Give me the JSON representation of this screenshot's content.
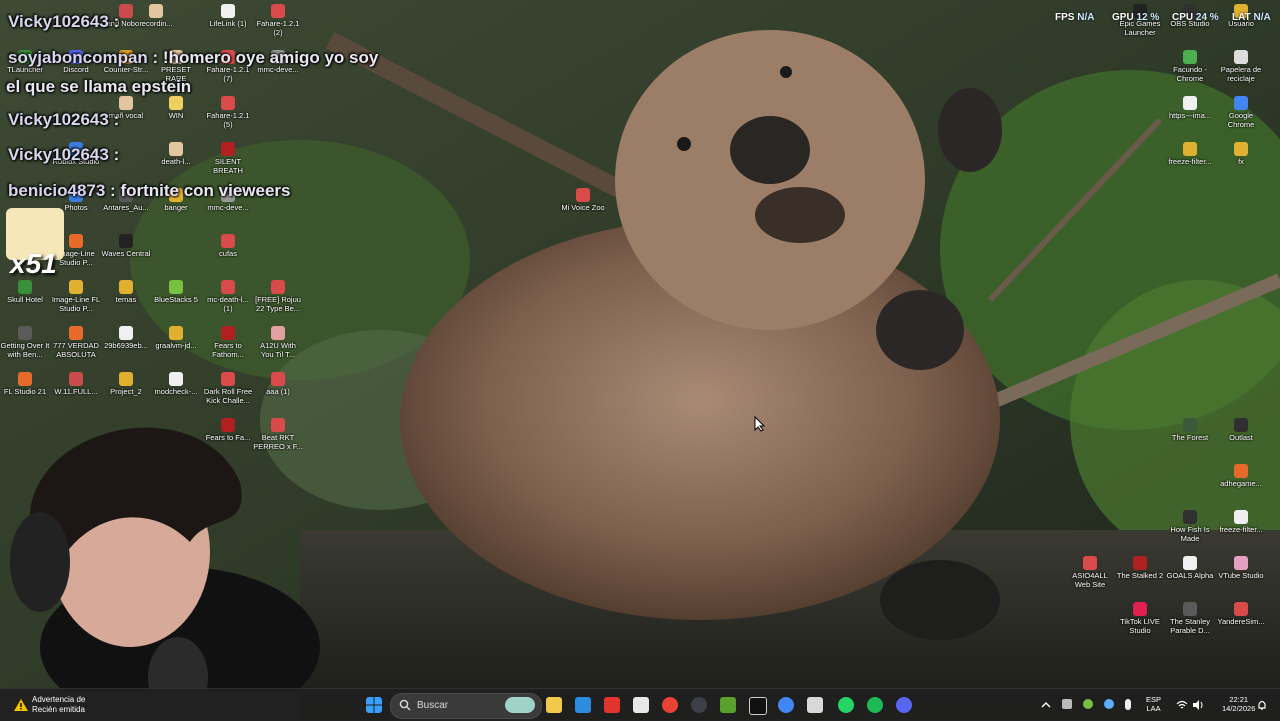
{
  "overlay": {
    "chat": [
      {
        "user": "Vicky102643",
        "sep": " :",
        "text": ""
      },
      {
        "user": "soyjaboncompan",
        "sep": " :",
        "text": " !homero oye amigo yo soy"
      },
      {
        "user": "",
        "sep": "",
        "text": "el que se llama epstein"
      },
      {
        "user": "Vicky102643",
        "sep": " :",
        "text": ""
      },
      {
        "user": "Vicky102643",
        "sep": " :",
        "text": ""
      },
      {
        "user": "benicio4873",
        "sep": " :",
        "text": " fortnite con vieweers"
      }
    ],
    "combo": "x51",
    "hud": {
      "fps_label": "FPS",
      "fps_value": "N/A",
      "gpu_label": "GPU",
      "gpu_value": "12 %",
      "cpu_label": "CPU",
      "cpu_value": "24 %",
      "lat_label": "LAT",
      "lat_value": "N/A"
    }
  },
  "desktop": {
    "icons": [
      {
        "label": "and Nobo...",
        "color": "#c94b4b"
      },
      {
        "label": "recordin...",
        "color": "#e3c6a0"
      },
      {
        "label": "LifeLink (1)",
        "color": "#f0f0f0"
      },
      {
        "label": "Fahare-1.2.1 (2)",
        "color": "#d94a4a"
      },
      {
        "label": "TLauncher",
        "color": "#3a8f3a"
      },
      {
        "label": "Discord",
        "color": "#5865f2"
      },
      {
        "label": "Counter-Str...",
        "color": "#e0a030"
      },
      {
        "label": "PRESET RARE",
        "color": "#e3c6a0"
      },
      {
        "label": "Fahare-1.2.1 (7)",
        "color": "#d94a4a"
      },
      {
        "label": "mmc-deve...",
        "color": "#999999"
      },
      {
        "label": "mañ vocal",
        "color": "#e3c6a0"
      },
      {
        "label": "WIN",
        "color": "#f0d060"
      },
      {
        "label": "Fahare-1.2.1 (5)",
        "color": "#d94a4a"
      },
      {
        "label": "Roblox Studio",
        "color": "#3b7de0"
      },
      {
        "label": "death-l...",
        "color": "#e3c6a0"
      },
      {
        "label": "SILENT BREATH",
        "color": "#b02020"
      },
      {
        "label": "Photos",
        "color": "#3b7de0"
      },
      {
        "label": "Antares_Au...",
        "color": "#5a5a5a"
      },
      {
        "label": "banger",
        "color": "#e0b030"
      },
      {
        "label": "mmc-deve...",
        "color": "#999999"
      },
      {
        "label": "Image-Line Studio P...",
        "color": "#e86a2a"
      },
      {
        "label": "Waves Central",
        "color": "#222222"
      },
      {
        "label": "cufas",
        "color": "#d94a4a"
      },
      {
        "label": "Skull Hotel",
        "color": "#3a8f3a"
      },
      {
        "label": "Image-Line FL Studio P...",
        "color": "#e0b030"
      },
      {
        "label": "temas",
        "color": "#e0b030"
      },
      {
        "label": "BlueStacks 5",
        "color": "#7ac043"
      },
      {
        "label": "mc-death-l... (1)",
        "color": "#d94a4a"
      },
      {
        "label": "[FREE] Rojuu 22 Type Be...",
        "color": "#d94a4a"
      },
      {
        "label": "Getting Over It with Ben...",
        "color": "#5a5a5a"
      },
      {
        "label": "777 VERDAD ABSOLUTA",
        "color": "#e86a2a"
      },
      {
        "label": "29b6939eb...",
        "color": "#f0f0f0"
      },
      {
        "label": "graalvm-jd...",
        "color": "#e0b030"
      },
      {
        "label": "Fears to Fathom...",
        "color": "#b02020"
      },
      {
        "label": "A12U With You Til T...",
        "color": "#e3a0a0"
      },
      {
        "label": "FL Studio 21",
        "color": "#e86a2a"
      },
      {
        "label": "W.11.FULL...",
        "color": "#c94b4b"
      },
      {
        "label": "Project_2",
        "color": "#e0b030"
      },
      {
        "label": "modcheck-...",
        "color": "#f0f0f0"
      },
      {
        "label": "Dark Roll Free Kick Challe...",
        "color": "#d94a4a"
      },
      {
        "label": "aaa (1)",
        "color": "#d94a4a"
      },
      {
        "label": "Fears to Fa...",
        "color": "#b02020"
      },
      {
        "label": "Beat RKT PERREO x F...",
        "color": "#d94a4a"
      },
      {
        "label": "Mi Voice Zoo",
        "color": "#d94a4a"
      },
      {
        "label": "Epic Games Launcher",
        "color": "#222222"
      },
      {
        "label": "OBS Studio",
        "color": "#303030"
      },
      {
        "label": "Usuario",
        "color": "#e0b030"
      },
      {
        "label": "Facundo - Chrome",
        "color": "#4caf50"
      },
      {
        "label": "Papelera de reciclaje",
        "color": "#dddddd"
      },
      {
        "label": "https---ima...",
        "color": "#f0f0f0"
      },
      {
        "label": "Google Chrome",
        "color": "#4285f4"
      },
      {
        "label": "freeze-filter...",
        "color": "#e0b030"
      },
      {
        "label": "fx",
        "color": "#e0b030"
      },
      {
        "label": "The Forest",
        "color": "#3a5a3a"
      },
      {
        "label": "Outlast",
        "color": "#303030"
      },
      {
        "label": "adhegame...",
        "color": "#e86a2a"
      },
      {
        "label": "How Fish Is Made",
        "color": "#303030"
      },
      {
        "label": "freeze-filter...",
        "color": "#f0f0f0"
      },
      {
        "label": "ASIO4ALL Web Site",
        "color": "#d94a4a"
      },
      {
        "label": "The Stalked 2",
        "color": "#b02020"
      },
      {
        "label": "GOALS Alpha",
        "color": "#f0f0f0"
      },
      {
        "label": "VTube Studio",
        "color": "#e3a0c0"
      },
      {
        "label": "TikTok LIVE Studio",
        "color": "#e02050"
      },
      {
        "label": "The Stanley Parable D...",
        "color": "#5a5a5a"
      },
      {
        "label": "YandereSim...",
        "color": "#d94a4a"
      }
    ]
  },
  "taskbar": {
    "notification": {
      "line1": "Advertencia de",
      "line2": "Recién emitida"
    },
    "search_placeholder": "Buscar",
    "pinned": [
      "windows-start",
      "file-explorer",
      "vscode",
      "wps",
      "store",
      "chrome",
      "steam",
      "minecraft",
      "chrome-2",
      "capcut",
      "whatsapp",
      "spotify",
      "discord"
    ],
    "lang_line1": "ESP",
    "lang_line2": "LAA",
    "time": "22:21",
    "date": "14/2/2026"
  }
}
